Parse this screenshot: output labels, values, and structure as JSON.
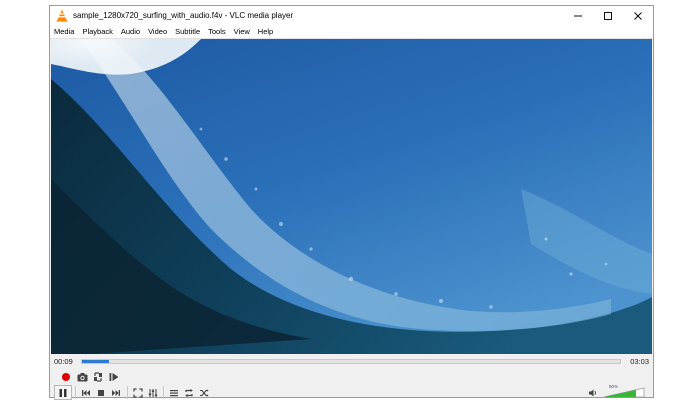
{
  "window": {
    "title": "sample_1280x720_surfing_with_audio.f4v - VLC media player",
    "app_icon": "vlc-cone-icon",
    "controls": [
      "minimize-icon",
      "maximize-icon",
      "close-icon"
    ]
  },
  "menu": [
    "Media",
    "Playback",
    "Audio",
    "Video",
    "Subtitle",
    "Tools",
    "View",
    "Help"
  ],
  "playback": {
    "elapsed": "00:09",
    "total": "03:03",
    "progress_fraction": 0.05
  },
  "controls_row1": [
    "record-icon",
    "snapshot-icon",
    "loop-ab-icon",
    "frame-step-icon"
  ],
  "controls_row2": [
    "pause-icon",
    "previous-icon",
    "stop-icon",
    "next-icon",
    "fullscreen-icon",
    "extended-settings-icon",
    "playlist-icon",
    "loop-icon",
    "shuffle-icon"
  ],
  "volume": {
    "label": "80%",
    "level_fraction": 0.8,
    "icon": "speaker-icon"
  },
  "colors": {
    "accent": "#2a7cd3",
    "record": "#e00000",
    "volume_fill": "#3cb43c",
    "vlc_orange": "#ff8800"
  }
}
